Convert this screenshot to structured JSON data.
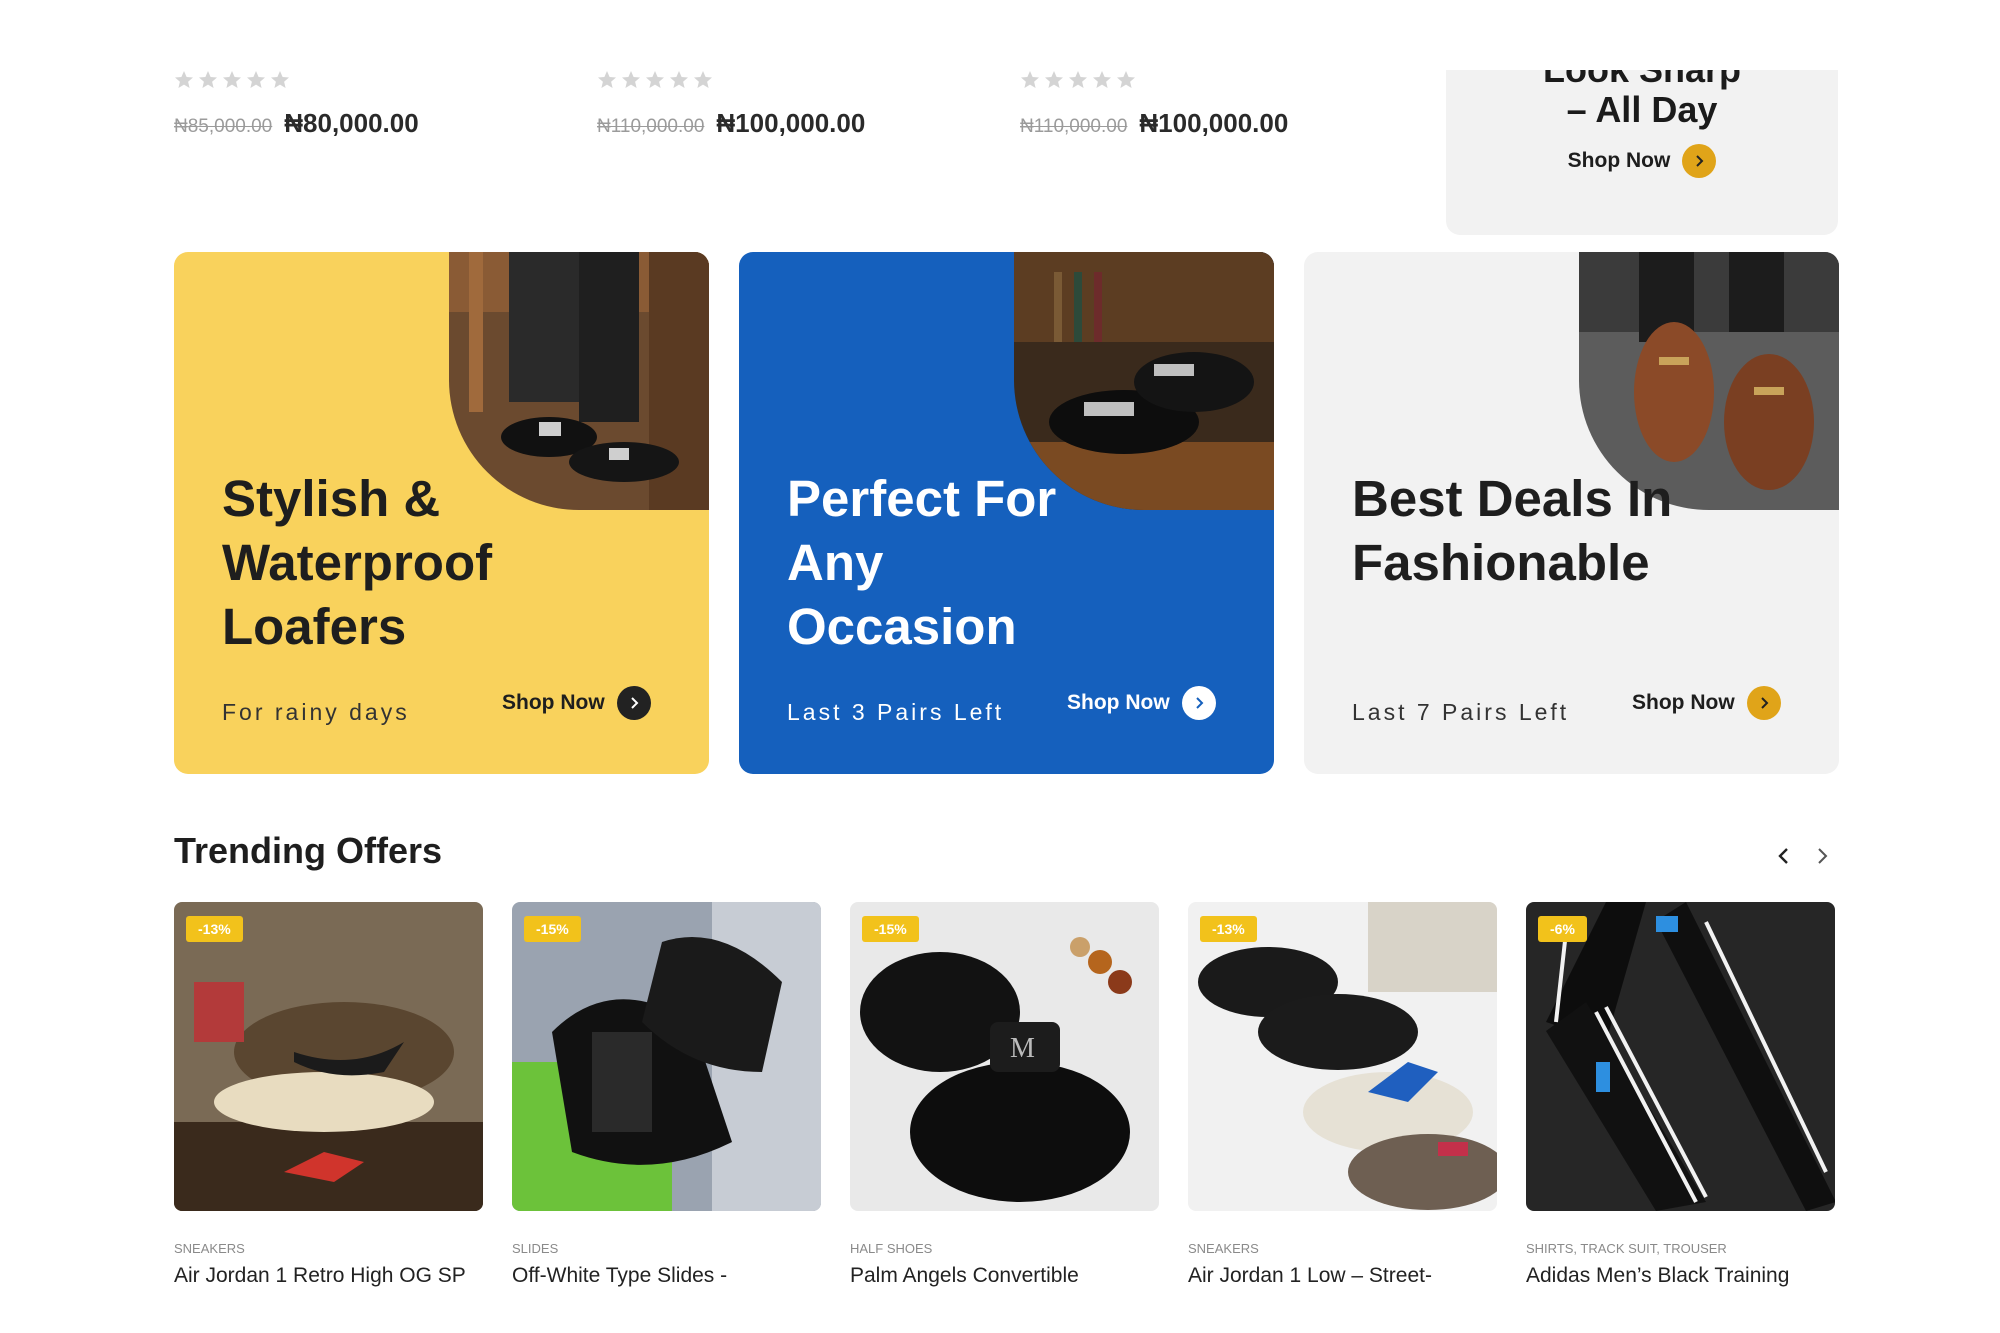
{
  "colors": {
    "yellow_banner": "#f9d25c",
    "blue_banner": "#1560bd",
    "gray_banner": "#f2f2f2",
    "accent_gold": "#e0a419",
    "badge": "#f2c21b",
    "dark_circle": "#222222"
  },
  "top_row": {
    "items": [
      {
        "old_price": "₦85,000.00",
        "price": "₦80,000.00",
        "stars": 0
      },
      {
        "old_price": "₦110,000.00",
        "price": "₦100,000.00",
        "stars": 0
      },
      {
        "old_price": "₦110,000.00",
        "price": "₦100,000.00",
        "stars": 0
      }
    ],
    "look_card": {
      "title_line1": "Look Sharp",
      "title_line2": "– All Day",
      "shop_label": "Shop Now",
      "icon": "chevron-right-icon"
    }
  },
  "banners": [
    {
      "title": "Stylish & Waterproof Loafers",
      "subtitle": "For rainy days",
      "shop_label": "Shop Now",
      "image": "loafers-photo"
    },
    {
      "title": "Perfect For Any Occasion",
      "subtitle": "Last 3 Pairs Left",
      "shop_label": "Shop Now",
      "image": "patent-shoes-photo"
    },
    {
      "title": "Best Deals In Fashionable",
      "subtitle": "Last 7 Pairs Left",
      "shop_label": "Shop Now",
      "image": "brown-loafers-photo"
    }
  ],
  "trending": {
    "title": "Trending Offers",
    "prev_icon": "chevron-left-icon",
    "next_icon": "chevron-right-icon",
    "products": [
      {
        "badge": "-13%",
        "category": "SNEAKERS",
        "name": "Air Jordan 1 Retro High OG SP",
        "image": "sneaker-box-photo"
      },
      {
        "badge": "-15%",
        "category": "SLIDES",
        "name": "Off-White Type Slides -",
        "image": "slides-photo"
      },
      {
        "badge": "-15%",
        "category": "HALF SHOES",
        "name": "Palm Angels Convertible",
        "image": "half-shoe-photo"
      },
      {
        "badge": "-13%",
        "category": "SNEAKERS",
        "name": "Air Jordan 1 Low – Street-",
        "image": "low-sneakers-photo"
      },
      {
        "badge": "-6%",
        "category": "SHIRTS, TRACK SUIT, TROUSER",
        "name": "Adidas Men’s Black Training",
        "image": "tracksuit-photo"
      }
    ]
  }
}
